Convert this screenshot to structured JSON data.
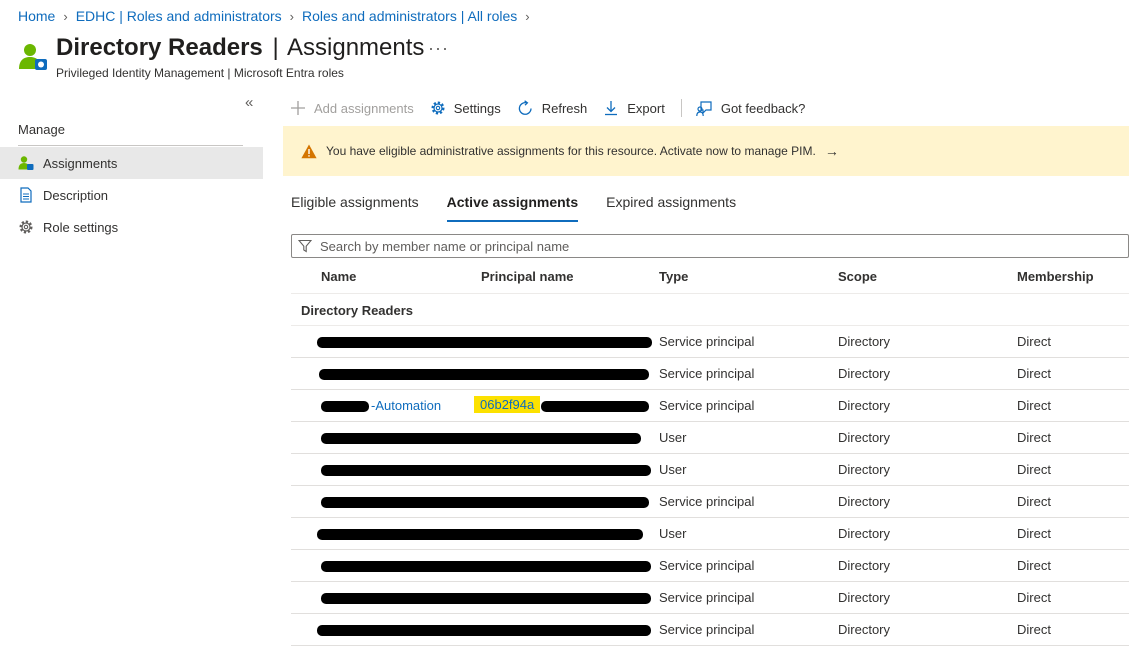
{
  "breadcrumb": [
    "Home",
    "EDHC | Roles and administrators",
    "Roles and administrators | All roles"
  ],
  "header": {
    "title_main": "Directory Readers",
    "title_separator": "|",
    "title_section": "Assignments",
    "more": "···",
    "subtitle": "Privileged Identity Management | Microsoft Entra roles"
  },
  "sidebar": {
    "collapse": "«",
    "section": "Manage",
    "items": [
      {
        "label": "Assignments",
        "icon": "users-icon",
        "active": true
      },
      {
        "label": "Description",
        "icon": "document-icon"
      },
      {
        "label": "Role settings",
        "icon": "gear-icon"
      }
    ]
  },
  "toolbar": {
    "add": "Add assignments",
    "settings": "Settings",
    "refresh": "Refresh",
    "export": "Export",
    "feedback": "Got feedback?"
  },
  "banner": {
    "text": "You have eligible administrative assignments for this resource. Activate now to manage PIM.",
    "arrow": "→"
  },
  "tabs": [
    "Eligible assignments",
    "Active assignments",
    "Expired assignments"
  ],
  "search": {
    "placeholder": "Search by member name or principal name",
    "value": ""
  },
  "table": {
    "columns": [
      "Name",
      "Principal name",
      "Type",
      "Scope",
      "Membership"
    ],
    "group": "Directory Readers",
    "rows": [
      {
        "name": "",
        "principal": "",
        "type": "Service principal",
        "scope": "Directory",
        "membership": "Direct"
      },
      {
        "name": "",
        "principal": "",
        "type": "Service principal",
        "scope": "Directory",
        "membership": "Direct"
      },
      {
        "name": "-Automation",
        "principal": "06b2f94a",
        "type": "Service principal",
        "scope": "Directory",
        "membership": "Direct"
      },
      {
        "name": "",
        "principal": "",
        "type": "User",
        "scope": "Directory",
        "membership": "Direct"
      },
      {
        "name": "",
        "principal": "",
        "type": "User",
        "scope": "Directory",
        "membership": "Direct"
      },
      {
        "name": "",
        "principal": "",
        "type": "Service principal",
        "scope": "Directory",
        "membership": "Direct"
      },
      {
        "name": "",
        "principal": "",
        "type": "User",
        "scope": "Directory",
        "membership": "Direct"
      },
      {
        "name": "",
        "principal": "",
        "type": "Service principal",
        "scope": "Directory",
        "membership": "Direct"
      },
      {
        "name": "",
        "principal": "",
        "type": "Service principal",
        "scope": "Directory",
        "membership": "Direct"
      },
      {
        "name": "",
        "principal": "",
        "type": "Service principal",
        "scope": "Directory",
        "membership": "Direct"
      }
    ]
  },
  "colors": {
    "accent": "#0f6cbd",
    "banner": "#fff4ce",
    "warning": "#d47500",
    "highlight": "#fce100",
    "selected_nav": "#e8e8e8"
  }
}
